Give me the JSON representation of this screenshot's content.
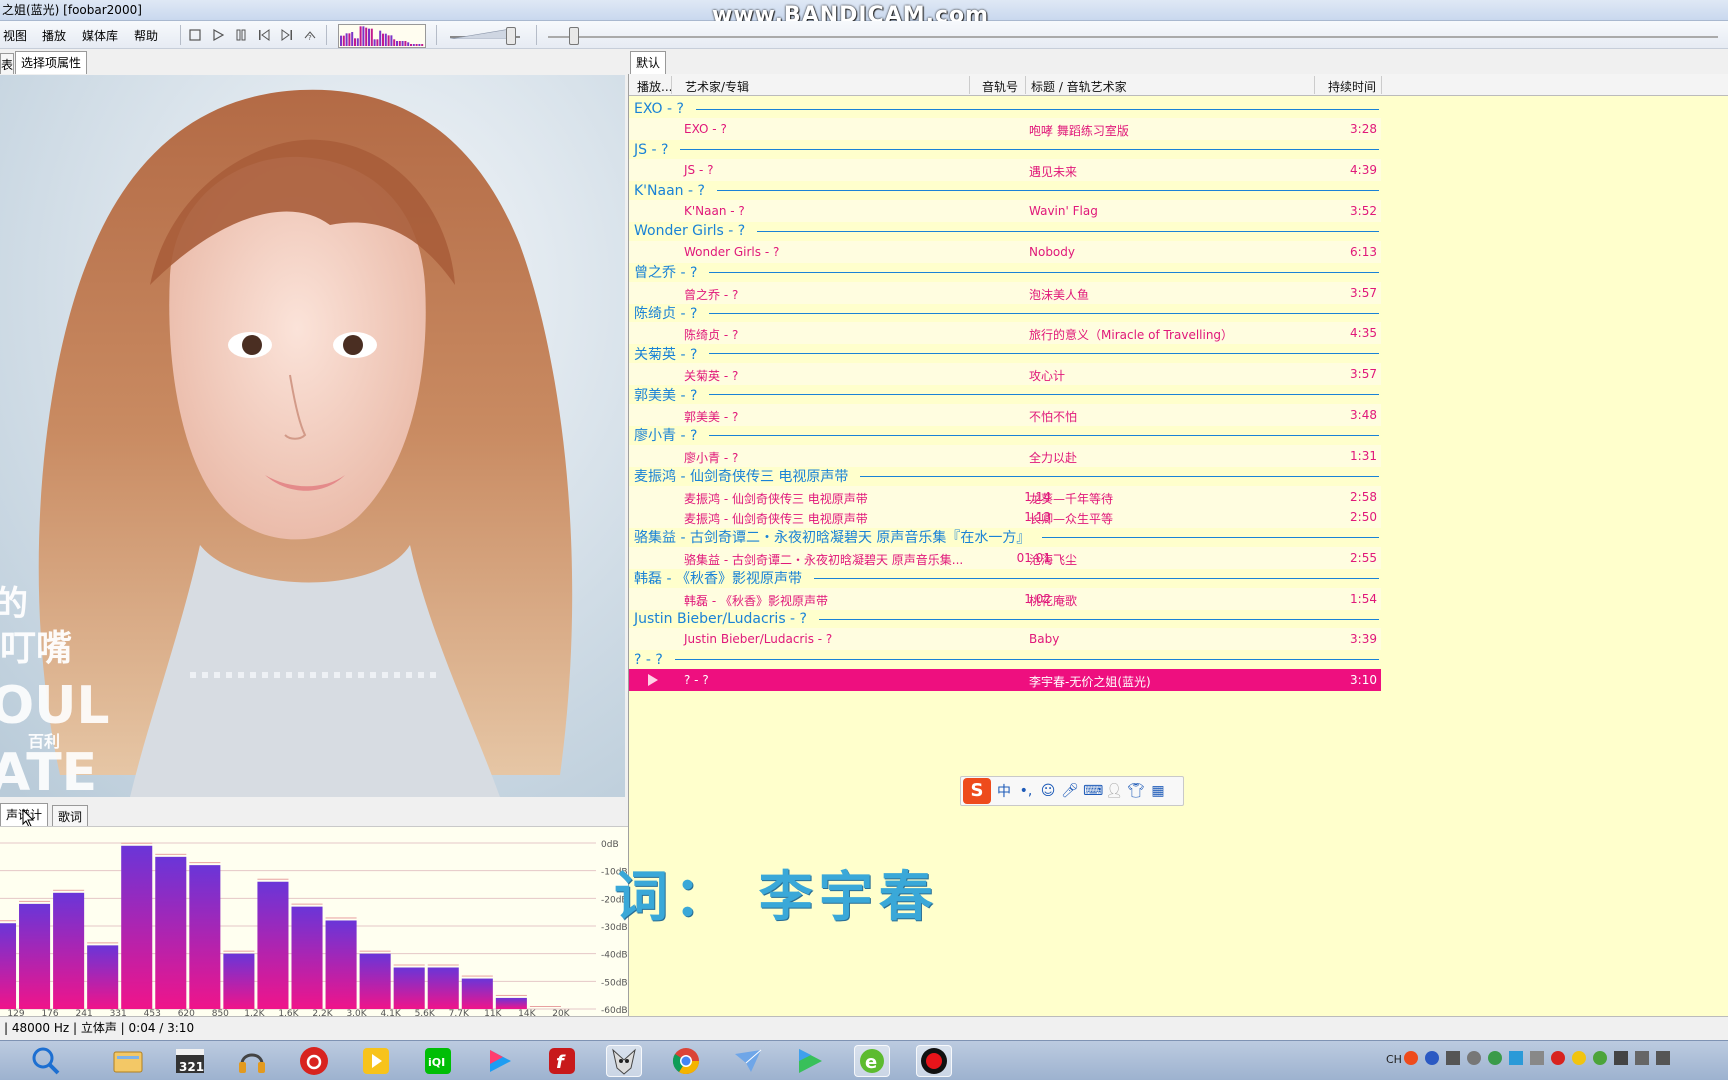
{
  "window": {
    "title": "之姐(蓝光)  [foobar2000]",
    "watermark": "www.BANDICAM.com"
  },
  "menu": [
    "视图",
    "播放",
    "媒体库",
    "帮助"
  ],
  "left_tabs": [
    "表",
    "选择项属性"
  ],
  "bottom_tabs": [
    "声谱计",
    "歌词"
  ],
  "playlist_tab": "默认",
  "columns": {
    "playing": "播放...",
    "artist_album": "艺术家/专辑",
    "track_no": "音轨号",
    "title_artist": "标题 / 音轨艺术家",
    "duration": "持续时间"
  },
  "groups": [
    {
      "name": "EXO - ?",
      "tracks": [
        {
          "artist": "EXO - ?",
          "no": "",
          "title": "咆哮 舞蹈练习室版",
          "dur": "3:28"
        }
      ]
    },
    {
      "name": "JS - ?",
      "tracks": [
        {
          "artist": "JS - ?",
          "no": "",
          "title": "遇见未来",
          "dur": "4:39"
        }
      ]
    },
    {
      "name": "K'Naan - ?",
      "tracks": [
        {
          "artist": "K'Naan - ?",
          "no": "",
          "title": "Wavin' Flag",
          "dur": "3:52"
        }
      ]
    },
    {
      "name": "Wonder Girls - ?",
      "tracks": [
        {
          "artist": "Wonder Girls - ?",
          "no": "",
          "title": "Nobody",
          "dur": "6:13"
        }
      ]
    },
    {
      "name": "曾之乔 - ?",
      "tracks": [
        {
          "artist": "曾之乔 - ?",
          "no": "",
          "title": "泡沫美人鱼",
          "dur": "3:57"
        }
      ]
    },
    {
      "name": "陈绮贞 - ?",
      "tracks": [
        {
          "artist": "陈绮贞 - ?",
          "no": "",
          "title": "旅行的意义（Miracle of Travelling）",
          "dur": "4:35"
        }
      ]
    },
    {
      "name": "关菊英 - ?",
      "tracks": [
        {
          "artist": "关菊英 - ?",
          "no": "",
          "title": "攻心计",
          "dur": "3:57"
        }
      ]
    },
    {
      "name": "郭美美 - ?",
      "tracks": [
        {
          "artist": "郭美美 - ?",
          "no": "",
          "title": "不怕不怕",
          "dur": "3:48"
        }
      ]
    },
    {
      "name": "廖小青 - ?",
      "tracks": [
        {
          "artist": "廖小青 - ?",
          "no": "",
          "title": "全力以赴",
          "dur": "1:31"
        }
      ]
    },
    {
      "name": "麦振鸿 - 仙剑奇侠传三 电视原声带",
      "tracks": [
        {
          "artist": "麦振鸿 - 仙剑奇侠传三 电视原声带",
          "no": "1.14",
          "title": "龙葵—千年等待",
          "dur": "2:58"
        },
        {
          "artist": "麦振鸿 - 仙剑奇侠传三 电视原声带",
          "no": "1.13",
          "title": "长卿—众生平等",
          "dur": "2:50"
        }
      ]
    },
    {
      "name": "骆集益 - 古剑奇谭二・永夜初晗凝碧天 原声音乐集『在水一方』",
      "tracks": [
        {
          "artist": "骆集益 - 古剑奇谭二・永夜初晗凝碧天 原声音乐集...",
          "no": "01.01",
          "title": "沧海飞尘",
          "dur": "2:55"
        }
      ]
    },
    {
      "name": "韩磊 - 《秋香》影视原声带",
      "tracks": [
        {
          "artist": "韩磊 - 《秋香》影视原声带",
          "no": "1.02",
          "title": "桃花庵歌",
          "dur": "1:54"
        }
      ]
    },
    {
      "name": "Justin Bieber/Ludacris - ?",
      "tracks": [
        {
          "artist": "Justin Bieber/Ludacris - ?",
          "no": "",
          "title": "Baby",
          "dur": "3:39"
        }
      ]
    },
    {
      "name": "? - ?",
      "tracks": [
        {
          "artist": "? - ?",
          "no": "",
          "title": "李宇春-无价之姐(蓝光)",
          "dur": "3:10",
          "playing": true
        }
      ]
    }
  ],
  "album_text": [
    "的",
    "叮嘴",
    "OUL",
    "ATE",
    "百利"
  ],
  "spectrum": {
    "db_labels": [
      "0dB",
      "-10dB",
      "-20dB",
      "-30dB",
      "-40dB",
      "-50dB",
      "-60dB"
    ],
    "freq_labels": [
      "129",
      "176",
      "241",
      "331",
      "453",
      "620",
      "850",
      "1.2K",
      "1.6K",
      "2.2K",
      "3.0K",
      "4.1K",
      "5.6K",
      "7.7K",
      "11K",
      "14K",
      "20K"
    ],
    "bar_levels_db": [
      -29,
      -22,
      -18,
      -37,
      -1,
      -5,
      -8,
      -40,
      -14,
      -23,
      -28,
      -40,
      -45,
      -45,
      -49,
      -56,
      -60,
      -65
    ],
    "colors": {
      "top": "#6a35d8",
      "bottom": "#f0148a"
    }
  },
  "lyric": "词：  李宇春",
  "status": "| 48000 Hz | 立体声 | 0:04 / 3:10",
  "taskbar": {
    "icons": [
      "search-icon",
      "explorer-icon",
      "media-321-icon",
      "headphones-icon",
      "netease-music-icon",
      "pplayer-icon",
      "iqiyi-icon",
      "youku-icon",
      "flash-icon",
      "foobar-icon",
      "chrome-icon",
      "mail-icon",
      "video-player-icon",
      "ie-icon",
      "record-icon"
    ],
    "tray_text": "CH"
  },
  "colors": {
    "playlist_bg": "#ffffcc",
    "group_color": "#1a82d6",
    "track_color": "#e0187a",
    "playing_bg": "#ee0f7f"
  }
}
